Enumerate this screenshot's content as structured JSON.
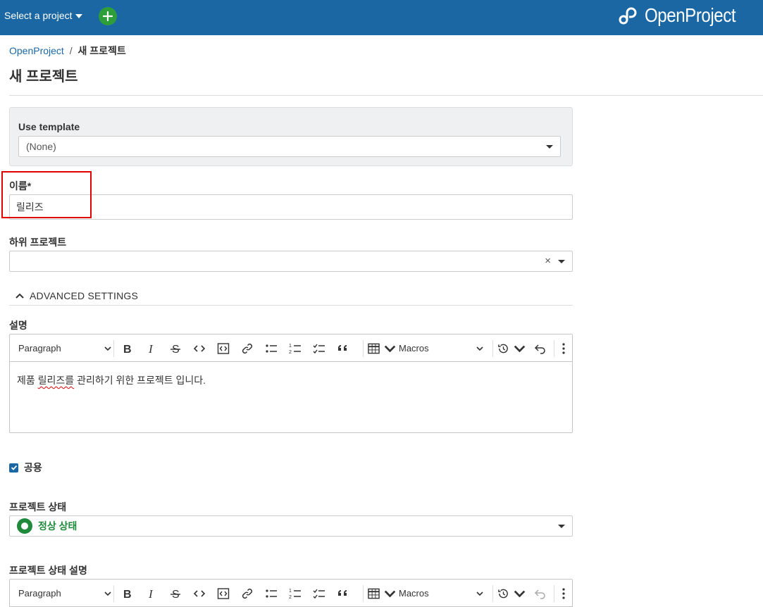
{
  "topbar": {
    "project_select": "Select a project",
    "logo_text": "OpenProject"
  },
  "breadcrumb": {
    "root": "OpenProject",
    "separator": "/",
    "current": "새 프로젝트"
  },
  "page": {
    "title": "새 프로젝트"
  },
  "form": {
    "template_label": "Use template",
    "template_value": "(None)",
    "name_label": "이름*",
    "name_value": "릴리즈",
    "parent_label": "하위 프로젝트",
    "parent_value": "",
    "parent_clear": "×",
    "advanced_label": "ADVANCED SETTINGS",
    "description_label": "설명",
    "description_value_misspelled": "릴리즈를",
    "description_value_prefix": "제품 ",
    "description_value_suffix": " 관리하기 위한 프로젝트 입니다.",
    "public_label": "공용",
    "public_checked": true,
    "status_label": "프로젝트 상태",
    "status_value": "정상 상태",
    "status_color": "#1f8a3b",
    "status_description_label": "프로젝트 상태 설명"
  },
  "editor_toolbar": {
    "paragraph": "Paragraph",
    "macros": "Macros",
    "icons": [
      "bold-icon",
      "italic-icon",
      "strikethrough-icon",
      "code-icon",
      "code-block-icon",
      "link-icon",
      "bulleted-list-icon",
      "numbered-list-icon",
      "todo-list-icon",
      "blockquote-icon",
      "table-icon",
      "history-icon",
      "undo-icon",
      "more-icon"
    ]
  },
  "colors": {
    "header": "#1a67a3",
    "add_button": "#2e9e3b",
    "highlight": "#e00000"
  }
}
